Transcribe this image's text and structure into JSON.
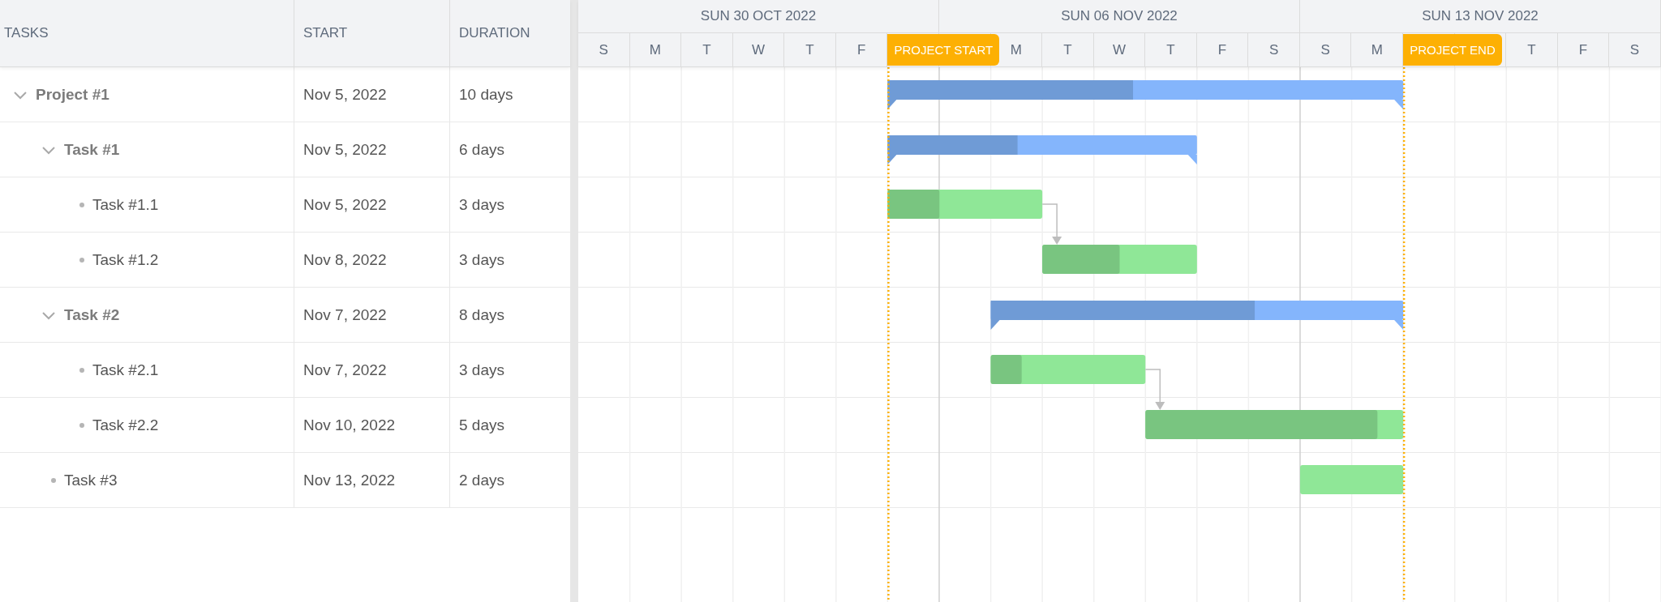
{
  "grid": {
    "columns": [
      "TASKS",
      "START",
      "DURATION"
    ]
  },
  "timeline": {
    "weeks": [
      {
        "label": "SUN 30 OCT 2022",
        "days": [
          {
            "kind": "day",
            "label": "S"
          },
          {
            "kind": "day",
            "label": "M"
          },
          {
            "kind": "day",
            "label": "T"
          },
          {
            "kind": "day",
            "label": "W"
          },
          {
            "kind": "day",
            "label": "T"
          },
          {
            "kind": "day",
            "label": "F"
          },
          {
            "kind": "covered"
          }
        ]
      },
      {
        "label": "SUN 06 NOV 2022",
        "days": [
          {
            "kind": "covered"
          },
          {
            "kind": "day",
            "label": "M"
          },
          {
            "kind": "day",
            "label": "T"
          },
          {
            "kind": "day",
            "label": "W"
          },
          {
            "kind": "day",
            "label": "T"
          },
          {
            "kind": "day",
            "label": "F"
          },
          {
            "kind": "day",
            "label": "S"
          }
        ]
      },
      {
        "label": "SUN 13 NOV 2022",
        "days": [
          {
            "kind": "day",
            "label": "S"
          },
          {
            "kind": "day",
            "label": "M"
          },
          {
            "kind": "covered"
          },
          {
            "kind": "covered"
          },
          {
            "kind": "day",
            "label": "T"
          },
          {
            "kind": "day",
            "label": "F"
          },
          {
            "kind": "day",
            "label": "S"
          }
        ]
      }
    ],
    "markers": [
      {
        "kind": "start",
        "label": "PROJECT START"
      },
      {
        "kind": "end",
        "label": "PROJECT END"
      }
    ]
  },
  "tasks": [
    {
      "name": "Project #1",
      "start": "Nov 5, 2022",
      "duration": "10 days",
      "kind": "summary",
      "level": 0.476,
      "expanded": true,
      "children": [
        {
          "name": "Task #1",
          "start": "Nov 5, 2022",
          "duration": "6 days",
          "kind": "summary",
          "level": 0.42,
          "expanded": true,
          "children": [
            {
              "name": "Task #1.1",
              "start": "Nov 5, 2022",
              "duration": "3 days",
              "kind": "task",
              "level": 0.335,
              "link_to_next": true
            },
            {
              "name": "Task #1.2",
              "start": "Nov 8, 2022",
              "duration": "3 days",
              "kind": "task",
              "level": 0.5
            }
          ]
        },
        {
          "name": "Task #2",
          "start": "Nov 7, 2022",
          "duration": "8 days",
          "kind": "summary",
          "level": 0.64,
          "expanded": true,
          "children": [
            {
              "name": "Task #2.1",
              "start": "Nov 7, 2022",
              "duration": "3 days",
              "kind": "task",
              "level": 0.2,
              "link_to_next": true
            },
            {
              "name": "Task #2.2",
              "start": "Nov 10, 2022",
              "duration": "5 days",
              "kind": "task",
              "level": 0.9
            }
          ]
        },
        {
          "name": "Task #3",
          "start": "Nov 13, 2022",
          "duration": "2 days",
          "kind": "task"
        }
      ]
    }
  ]
}
